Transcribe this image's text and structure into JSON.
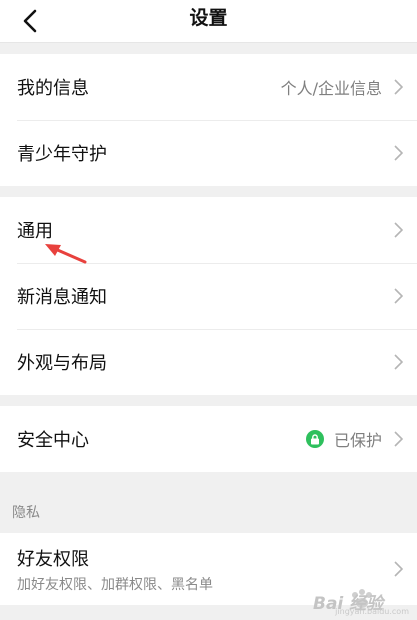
{
  "header": {
    "title": "设置",
    "back_icon": "chevron-left-icon"
  },
  "groups": [
    {
      "items": [
        {
          "label": "我的信息",
          "value": "个人/企业信息"
        },
        {
          "label": "青少年守护"
        }
      ]
    },
    {
      "items": [
        {
          "label": "通用"
        },
        {
          "label": "新消息通知"
        },
        {
          "label": "外观与布局"
        }
      ]
    },
    {
      "items": [
        {
          "label": "安全中心",
          "value": "已保护",
          "status_color": "#2ec05d"
        }
      ]
    }
  ],
  "privacy": {
    "section_label": "隐私",
    "items": [
      {
        "label": "好友权限",
        "sub": "加好友权限、加群权限、黑名单"
      }
    ]
  },
  "colors": {
    "accent_red": "#e8413d",
    "status_green": "#2ec05d"
  },
  "watermark": {
    "text": "Bai 经验",
    "subtext": "jingyan.baidu.com"
  }
}
